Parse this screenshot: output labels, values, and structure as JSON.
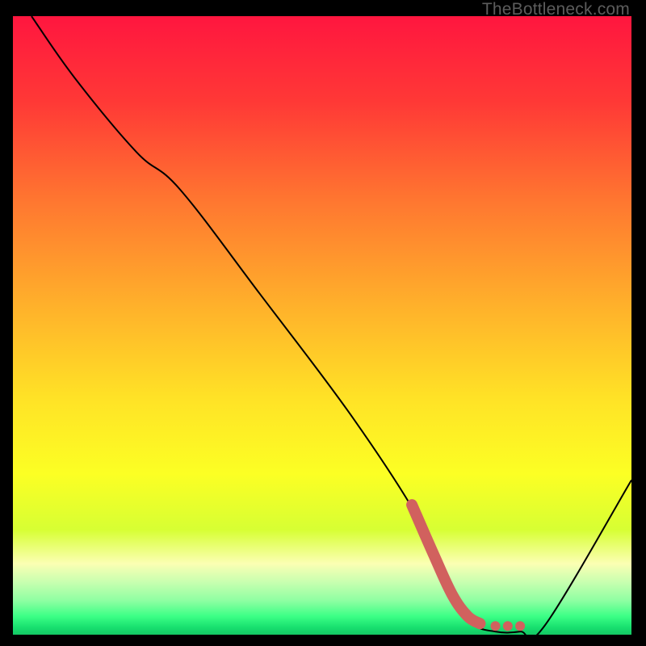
{
  "watermark": "TheBottleneck.com",
  "chart_data": {
    "type": "line",
    "title": "",
    "xlabel": "",
    "ylabel": "",
    "xlim": [
      0,
      100
    ],
    "ylim": [
      0,
      100
    ],
    "series": [
      {
        "name": "curve",
        "x": [
          3,
          10,
          20,
          27,
          40,
          55,
          66,
          70,
          74,
          78,
          82,
          86,
          100
        ],
        "y": [
          100,
          90,
          78,
          72,
          55,
          35,
          18,
          8,
          2,
          0.5,
          0.5,
          1.5,
          25
        ]
      },
      {
        "name": "highlight",
        "x": [
          64.5,
          68,
          71,
          73.5,
          75.5,
          78,
          80,
          82
        ],
        "y": [
          21,
          13,
          6.5,
          3,
          1.8,
          1.4,
          1.4,
          1.4
        ]
      }
    ],
    "gradient_stops": [
      {
        "offset": 0.0,
        "color": "#ff163f"
      },
      {
        "offset": 0.14,
        "color": "#ff3936"
      },
      {
        "offset": 0.3,
        "color": "#ff7730"
      },
      {
        "offset": 0.46,
        "color": "#ffae2b"
      },
      {
        "offset": 0.62,
        "color": "#ffe326"
      },
      {
        "offset": 0.74,
        "color": "#fcff24"
      },
      {
        "offset": 0.83,
        "color": "#d7ff33"
      },
      {
        "offset": 0.885,
        "color": "#fbffb3"
      },
      {
        "offset": 0.915,
        "color": "#c8ffb0"
      },
      {
        "offset": 0.945,
        "color": "#8effa2"
      },
      {
        "offset": 0.97,
        "color": "#3cff86"
      },
      {
        "offset": 0.988,
        "color": "#18e06f"
      },
      {
        "offset": 1.0,
        "color": "#13c764"
      }
    ],
    "colors": {
      "curve": "#000000",
      "highlight": "#d1615e",
      "background_border": "#000000"
    }
  }
}
